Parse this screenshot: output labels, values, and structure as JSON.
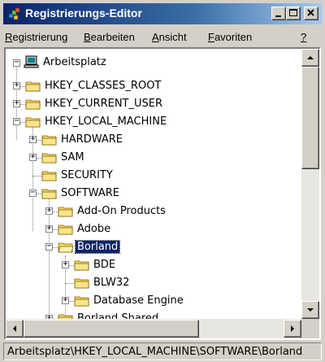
{
  "window": {
    "title": "Registrierungs-Editor",
    "controls": {
      "minimize": "minimize",
      "maximize": "maximize",
      "close": "close"
    }
  },
  "menu": [
    {
      "mn": "R",
      "rest": "egistrierung"
    },
    {
      "mn": "B",
      "rest": "earbeiten"
    },
    {
      "mn": "A",
      "rest": "nsicht"
    },
    {
      "mn": "F",
      "rest": "avoriten"
    },
    {
      "mn": "?",
      "rest": ""
    }
  ],
  "tree": {
    "root": "Arbeitsplatz",
    "nodes": [
      {
        "label": "HKEY_CLASSES_ROOT",
        "expander": "+"
      },
      {
        "label": "HKEY_CURRENT_USER",
        "expander": "+"
      },
      {
        "label": "HKEY_LOCAL_MACHINE",
        "expander": "−"
      },
      {
        "label": "HARDWARE",
        "expander": "+"
      },
      {
        "label": "SAM",
        "expander": "+"
      },
      {
        "label": "SECURITY",
        "expander": ""
      },
      {
        "label": "SOFTWARE",
        "expander": "−"
      },
      {
        "label": "Add-On Products",
        "expander": "+"
      },
      {
        "label": "Adobe",
        "expander": "+"
      },
      {
        "label": "Borland",
        "expander": "−",
        "selected": true
      },
      {
        "label": "BDE",
        "expander": "+"
      },
      {
        "label": "BLW32",
        "expander": ""
      },
      {
        "label": "Database Engine",
        "expander": "+"
      },
      {
        "label": "Borland Shared",
        "expander": "+"
      }
    ]
  },
  "status": {
    "path": "Arbeitsplatz\\HKEY_LOCAL_MACHINE\\SOFTWARE\\Borland"
  },
  "colors": {
    "titlebar": "#0a246a",
    "selection": "#0a246a",
    "folder": "#f6d860"
  },
  "icons": {
    "app": "regedit-icon",
    "computer": "computer-icon",
    "folder": "folder-icon"
  }
}
